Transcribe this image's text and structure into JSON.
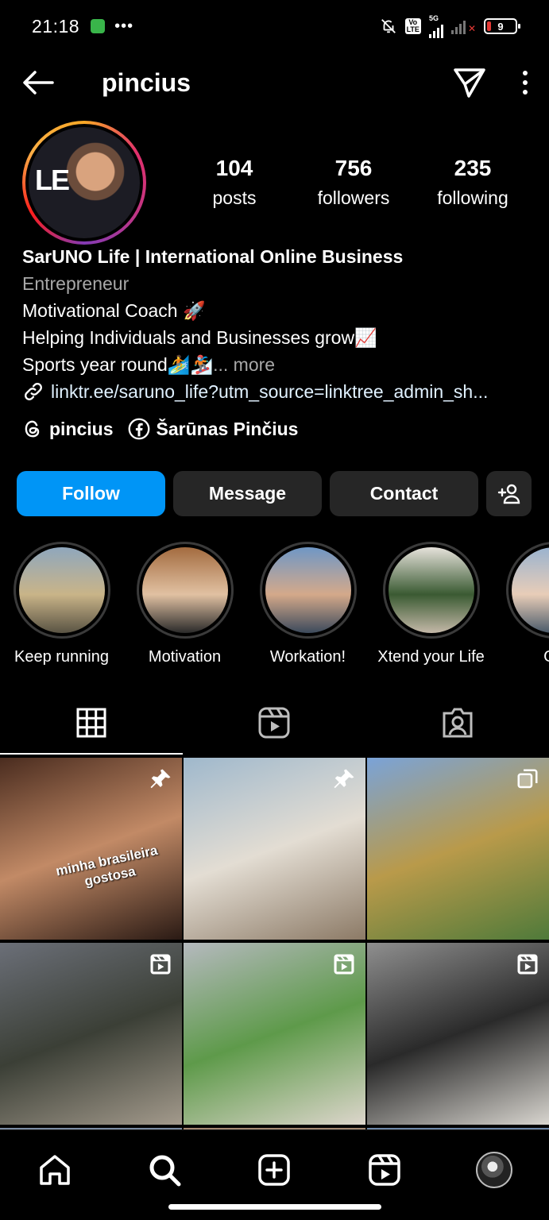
{
  "status_bar": {
    "time": "21:18",
    "network": "5G",
    "battery": "9"
  },
  "header": {
    "username": "pincius"
  },
  "profile": {
    "stats": [
      {
        "number": "104",
        "label": "posts"
      },
      {
        "number": "756",
        "label": "followers"
      },
      {
        "number": "235",
        "label": "following"
      }
    ],
    "bio": {
      "name": "SarUNO Life | International Online Business",
      "category": "Entrepreneur",
      "line1": "Motivational Coach 🚀",
      "line2": "Helping Individuals and Businesses grow📈",
      "line3": "Sports year round🏄🏂",
      "more": "... more",
      "link": "linktr.ee/saruno_life?utm_source=linktree_admin_sh..."
    },
    "socials": {
      "threads": "pincius",
      "facebook": "Šarūnas Pinčius"
    },
    "buttons": {
      "follow": "Follow",
      "message": "Message",
      "contact": "Contact"
    },
    "avatar_text": "LE"
  },
  "highlights": [
    {
      "label": "Keep running",
      "colors": [
        "#8fa7bd",
        "#c9b488",
        "#5a5444"
      ]
    },
    {
      "label": "Motivation",
      "colors": [
        "#a36b3f",
        "#e1c1a2",
        "#2a2a2a"
      ]
    },
    {
      "label": "Workation!",
      "colors": [
        "#6f97c6",
        "#d4a98a",
        "#3c4a5c"
      ]
    },
    {
      "label": "Xtend your Life",
      "colors": [
        "#e6e2db",
        "#3a5a32",
        "#c4b8a8"
      ]
    },
    {
      "label": "Go",
      "colors": [
        "#9ab3cf",
        "#e8cdb8",
        "#4a5a6a"
      ]
    }
  ],
  "grid": {
    "overlay_text": "minha brasileira gostosa",
    "posts": [
      {
        "type": "pinned",
        "colors": [
          "#4a2c1f",
          "#c28a66",
          "#2a1a14"
        ]
      },
      {
        "type": "pinned",
        "colors": [
          "#9fb8cc",
          "#e3ddd3",
          "#8c7a66"
        ]
      },
      {
        "type": "carousel",
        "colors": [
          "#7aa3d8",
          "#b99a4a",
          "#4f7a3a"
        ]
      },
      {
        "type": "reel",
        "colors": [
          "#6b6f78",
          "#3b3f36",
          "#a39a8c"
        ]
      },
      {
        "type": "reel",
        "colors": [
          "#b5b9be",
          "#5e9a4a",
          "#ddd6cc"
        ]
      },
      {
        "type": "reel",
        "colors": [
          "#8f8f8f",
          "#2a2a2a",
          "#d8d5cf"
        ]
      }
    ],
    "partial_colors": [
      "#7b8ca3",
      "#a58a74",
      "#6d87a8"
    ]
  }
}
